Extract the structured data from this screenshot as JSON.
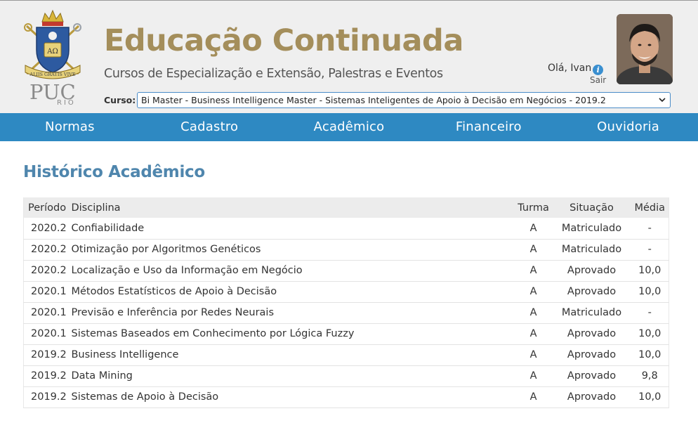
{
  "brand": {
    "logo_text": "PUC",
    "logo_subtext": "RIO",
    "seal_text": "ALIIS GRATIS VIVE",
    "seal_letters": "AΩ",
    "colors": {
      "gold": "#a48e5b",
      "nav_blue": "#2e89c2",
      "heading_blue": "#4f86ad"
    }
  },
  "header": {
    "title": "Educação Continuada",
    "subtitle": "Cursos de Especialização e Extensão, Palestras e Eventos",
    "greeting": "Olá, Ivan",
    "info_icon": "i",
    "logout_label": "Sair",
    "course_label": "Curso:",
    "course_selected": "Bi Master - Business Intelligence Master - Sistemas Inteligentes de Apoio à Decisão em Negócios - 2019.2"
  },
  "nav": {
    "items": [
      {
        "label": "Normas"
      },
      {
        "label": "Cadastro"
      },
      {
        "label": "Acadêmico"
      },
      {
        "label": "Financeiro"
      },
      {
        "label": "Ouvidoria"
      }
    ]
  },
  "main": {
    "heading": "Histórico Acadêmico",
    "table": {
      "columns": {
        "period": "Período",
        "discipline": "Disciplina",
        "class": "Turma",
        "status": "Situação",
        "grade": "Média"
      },
      "rows": [
        {
          "period": "2020.2",
          "discipline": "Confiabilidade",
          "class": "A",
          "status": "Matriculado",
          "grade": "-"
        },
        {
          "period": "2020.2",
          "discipline": "Otimização por Algoritmos Genéticos",
          "class": "A",
          "status": "Matriculado",
          "grade": "-"
        },
        {
          "period": "2020.2",
          "discipline": "Localização e Uso da Informação em Negócio",
          "class": "A",
          "status": "Aprovado",
          "grade": "10,0"
        },
        {
          "period": "2020.1",
          "discipline": "Métodos Estatísticos de Apoio à Decisão",
          "class": "A",
          "status": "Aprovado",
          "grade": "10,0"
        },
        {
          "period": "2020.1",
          "discipline": "Previsão e Inferência por Redes Neurais",
          "class": "A",
          "status": "Matriculado",
          "grade": "-"
        },
        {
          "period": "2020.1",
          "discipline": "Sistemas Baseados em Conhecimento por Lógica Fuzzy",
          "class": "A",
          "status": "Aprovado",
          "grade": "10,0"
        },
        {
          "period": "2019.2",
          "discipline": "Business Intelligence",
          "class": "A",
          "status": "Aprovado",
          "grade": "10,0"
        },
        {
          "period": "2019.2",
          "discipline": "Data Mining",
          "class": "A",
          "status": "Aprovado",
          "grade": "9,8"
        },
        {
          "period": "2019.2",
          "discipline": "Sistemas de Apoio à Decisão",
          "class": "A",
          "status": "Aprovado",
          "grade": "10,0"
        }
      ]
    }
  }
}
